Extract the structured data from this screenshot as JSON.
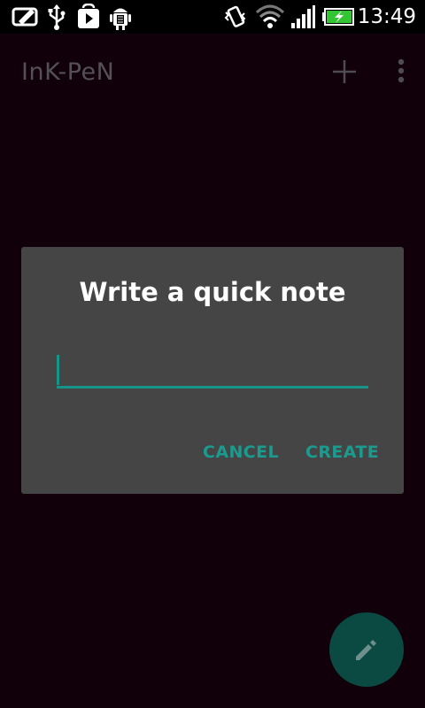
{
  "status_bar": {
    "time": "13:49",
    "icons": [
      "notification-icon",
      "usb-icon",
      "play-store-icon",
      "android-debug-icon",
      "vibrate-icon",
      "wifi-icon",
      "signal-icon",
      "battery-charging-icon"
    ]
  },
  "app": {
    "title": "InK-PeN",
    "add_icon": "plus-icon",
    "more_icon": "overflow-menu-icon"
  },
  "dialog": {
    "title": "Write a quick note",
    "input_value": "",
    "cancel_label": "CANCEL",
    "create_label": "CREATE"
  },
  "fab": {
    "icon": "pencil-icon"
  },
  "colors": {
    "background": "#110009",
    "dialog": "#454545",
    "accent": "#159589",
    "fab": "#0b4a43"
  }
}
